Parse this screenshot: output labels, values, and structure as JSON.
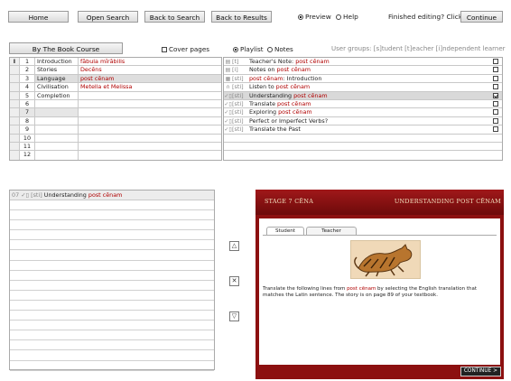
{
  "toolbar": {
    "home": "Home",
    "open_search": "Open Search",
    "back_to_search": "Back to Search",
    "back_to_results": "Back to Results",
    "preview": "Preview",
    "help": "Help",
    "finished": "Finished editing? Click",
    "continue": "Continue"
  },
  "controls": {
    "course_button": "By The Book Course",
    "cover_pages": "Cover pages",
    "playlist": "Playlist",
    "notes": "Notes",
    "user_groups": "User groups: [s]tudent [t]eacher [i]ndependent learner"
  },
  "left_table": {
    "header_marker": "I",
    "rows": [
      {
        "num": "1",
        "label": "Introduction",
        "value": "fābula mīrābilis"
      },
      {
        "num": "2",
        "label": "Stories",
        "value": "Decēns"
      },
      {
        "num": "3",
        "label": "Language",
        "value": "post cēnam"
      },
      {
        "num": "4",
        "label": "Civilisation",
        "value": "Metella et Melissa"
      },
      {
        "num": "5",
        "label": "Completion",
        "value": ""
      },
      {
        "num": "6",
        "label": "",
        "value": ""
      },
      {
        "num": "7",
        "label": "",
        "value": ""
      },
      {
        "num": "8",
        "label": "",
        "value": ""
      },
      {
        "num": "9",
        "label": "",
        "value": ""
      },
      {
        "num": "10",
        "label": "",
        "value": ""
      },
      {
        "num": "11",
        "label": "",
        "value": ""
      },
      {
        "num": "12",
        "label": "",
        "value": ""
      }
    ]
  },
  "right_table": {
    "rows": [
      {
        "icon": "▤",
        "tag": "[t]",
        "pre": "Teacher's Note: ",
        "red": "post cēnam"
      },
      {
        "icon": "▤",
        "tag": "[i]",
        "pre": "Notes on ",
        "red": "post cēnam"
      },
      {
        "icon": "▦",
        "tag": "[sti]",
        "pre": "",
        "red": "post cēnam",
        "post": ": Introduction"
      },
      {
        "icon": "∩",
        "tag": "[sti]",
        "pre": "Listen to ",
        "red": "post cēnam"
      },
      {
        "icon": "✓▯",
        "tag": "[sti]",
        "pre": "Understanding ",
        "red": "post cēnam"
      },
      {
        "icon": "✓▯",
        "tag": "[sti]",
        "pre": "Translate ",
        "red": "post cēnam"
      },
      {
        "icon": "✓▯",
        "tag": "[sti]",
        "pre": "Exploring ",
        "red": "post cēnam"
      },
      {
        "icon": "✓▯",
        "tag": "[sti]",
        "pre": "Perfect or Imperfect Verbs?",
        "red": ""
      },
      {
        "icon": "✓▯",
        "tag": "[sti]",
        "pre": "Translate the Past",
        "red": ""
      },
      {
        "icon": "",
        "tag": "",
        "pre": "",
        "red": ""
      },
      {
        "icon": "",
        "tag": "",
        "pre": "",
        "red": ""
      },
      {
        "icon": "",
        "tag": "",
        "pre": "",
        "red": ""
      }
    ]
  },
  "bottom_pane": {
    "num": "07",
    "icon": "✓▯",
    "tag": "[sti]",
    "pre": "Understanding ",
    "red": "post cēnam"
  },
  "arrows": {
    "up": "△",
    "remove": "✕",
    "down": "▽"
  },
  "preview": {
    "stage": "STAGE 7  CĒNA",
    "title": "UNDERSTANDING POST CĒNAM",
    "tab_student": "Student",
    "tab_teacher": "Teacher",
    "text_pre": "Translate the following lines from ",
    "text_red": "post cēnam",
    "text_post": " by selecting the English translation that matches the Latin sentence. The story is on page 89 of your textbook.",
    "continue": "CONTINUE >"
  },
  "colors": {
    "accent_red": "#b00000",
    "preview_bg": "#8c1010"
  }
}
